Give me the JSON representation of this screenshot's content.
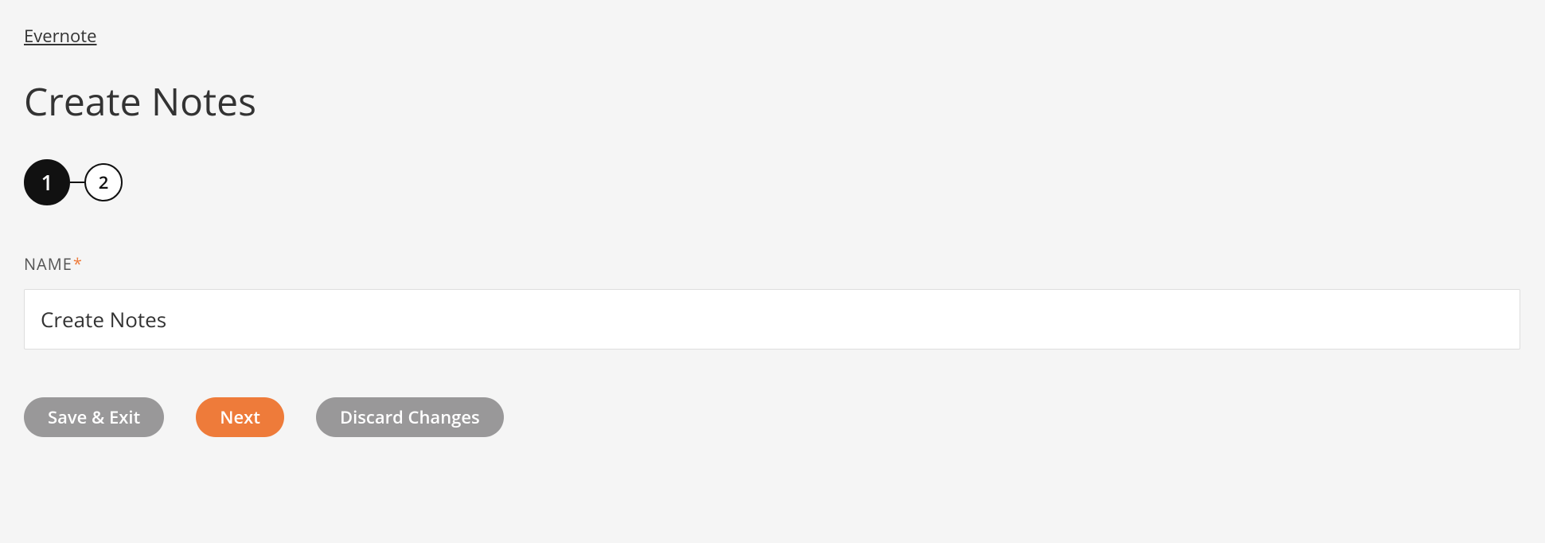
{
  "breadcrumb": {
    "parent_label": "Evernote"
  },
  "page_title": "Create Notes",
  "stepper": {
    "steps": [
      {
        "number": "1",
        "active": true
      },
      {
        "number": "2",
        "active": false
      }
    ]
  },
  "form": {
    "name_label": "NAME",
    "required_mark": "*",
    "name_value": "Create Notes"
  },
  "buttons": {
    "save_exit": "Save & Exit",
    "next": "Next",
    "discard": "Discard Changes"
  }
}
